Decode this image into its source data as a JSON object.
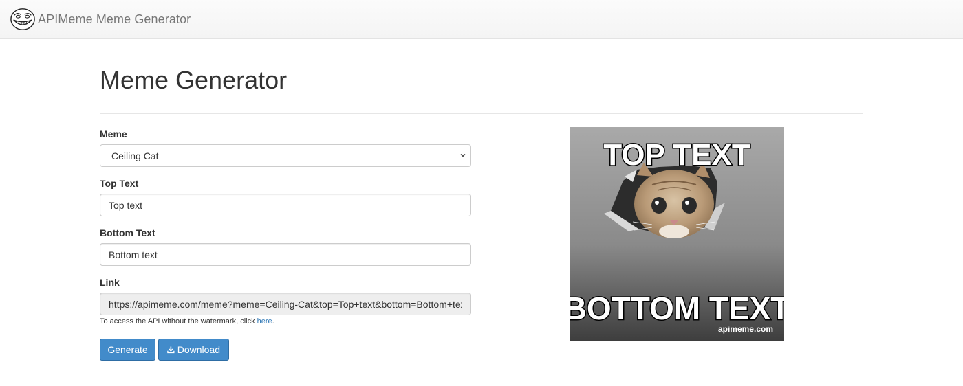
{
  "navbar": {
    "brand_text": "APIMeme Meme Generator",
    "logo_icon": "trollface-logo-icon"
  },
  "page": {
    "title": "Meme Generator"
  },
  "form": {
    "meme_label": "Meme",
    "meme_selected": "Ceiling Cat",
    "top_text_label": "Top Text",
    "top_text_value": "Top text",
    "bottom_text_label": "Bottom Text",
    "bottom_text_value": "Bottom text",
    "link_label": "Link",
    "link_value": "https://apimeme.com/meme?meme=Ceiling-Cat&top=Top+text&bottom=Bottom+text",
    "help_prefix": "To access the API without the watermark, click ",
    "help_link": "here",
    "help_suffix": "."
  },
  "buttons": {
    "generate_label": "Generate",
    "download_label": "Download",
    "download_icon": "download-icon"
  },
  "preview": {
    "top_caption": "TOP TEXT",
    "bottom_caption": "BOTTOM TEXT",
    "watermark": "apimeme.com"
  },
  "colors": {
    "primary": "#428bca",
    "link": "#337ab7",
    "navbar_bg": "#f8f8f8"
  }
}
